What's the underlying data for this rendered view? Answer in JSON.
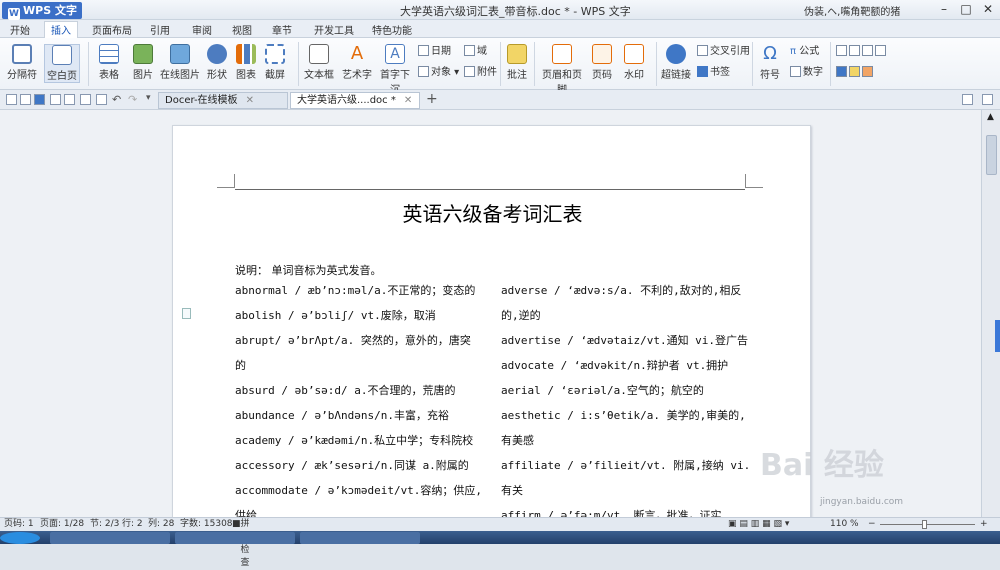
{
  "app": {
    "menu_label": "WPS 文字",
    "window_title": "大学英语六级词汇表_带音标.doc * - WPS 文字",
    "user": "伪装,ヘ,嘴角靶额的猪"
  },
  "menubar": {
    "tabs": [
      "开始",
      "插入",
      "页面布局",
      "引用",
      "审阅",
      "视图",
      "章节",
      "开发工具",
      "特色功能"
    ]
  },
  "ribbon": {
    "large": [
      "分隔符",
      "空白页",
      "表格",
      "图片",
      "在线图片",
      "形状",
      "图表",
      "截屏",
      "文本框",
      "艺术字",
      "首字下沉",
      "批注",
      "页眉和页脚",
      "页码",
      "水印",
      "超链接",
      "符号",
      "公式",
      "数字"
    ],
    "small": [
      "日期",
      "域",
      "对象",
      "附件",
      "交叉引用",
      "书签"
    ]
  },
  "doctabs": [
    "Docer-在线模板",
    "大学英语六级....doc *"
  ],
  "document": {
    "title": "英语六级备考词汇表",
    "intro": "说明： 单词音标为英式发音。",
    "left": [
      "abnormal / æb’nɔ:məl/a.不正常的；变态的",
      "abolish / ə’bɔliʃ/ vt.废除，取消",
      "abrupt/ ə’brΛpt/a. 突然的，意外的，唐突",
      "的",
      "absurd / əb’sə:d/ a.不合理的，荒唐的",
      "abundance / ə’bΛndəns/n.丰富，充裕",
      "academy / ə’kædəmi/n.私立中学；专科院校",
      "accessory / æk’sesəri/n.同谋 a.附属的",
      "accommodate / ə’kɔmədeit/vt.容纳；供应,",
      "供给"
    ],
    "right": [
      "adverse / ‘ædvə:s/a. 不利的,敌对的,相反",
      "的,逆的",
      "advertise / ‘ædvətaiz/vt.通知 vi.登广告",
      "advocate / ‘ædvəkit/n.辩护者 vt.拥护",
      "aerial / ‘εəriəl/a.空气的；航空的",
      "aesthetic / i:s’θetik/a. 美学的,审美的,",
      "有美感",
      "affiliate / ə’filieit/vt. 附属,接纳 vi.",
      "有关",
      "affirm / ə’fə:m/vt. 断言，批准，证实"
    ]
  },
  "status": {
    "page": "页码: 1",
    "pages": "页面: 1/28",
    "section": "节: 2/3",
    "row": "行: 2",
    "col": "列: 28",
    "words": "字数: 15308",
    "spell": "拼写检查",
    "zoom": "110 %"
  },
  "watermark": {
    "text": "Bai 经验",
    "url": "jingyan.baidu.com"
  }
}
